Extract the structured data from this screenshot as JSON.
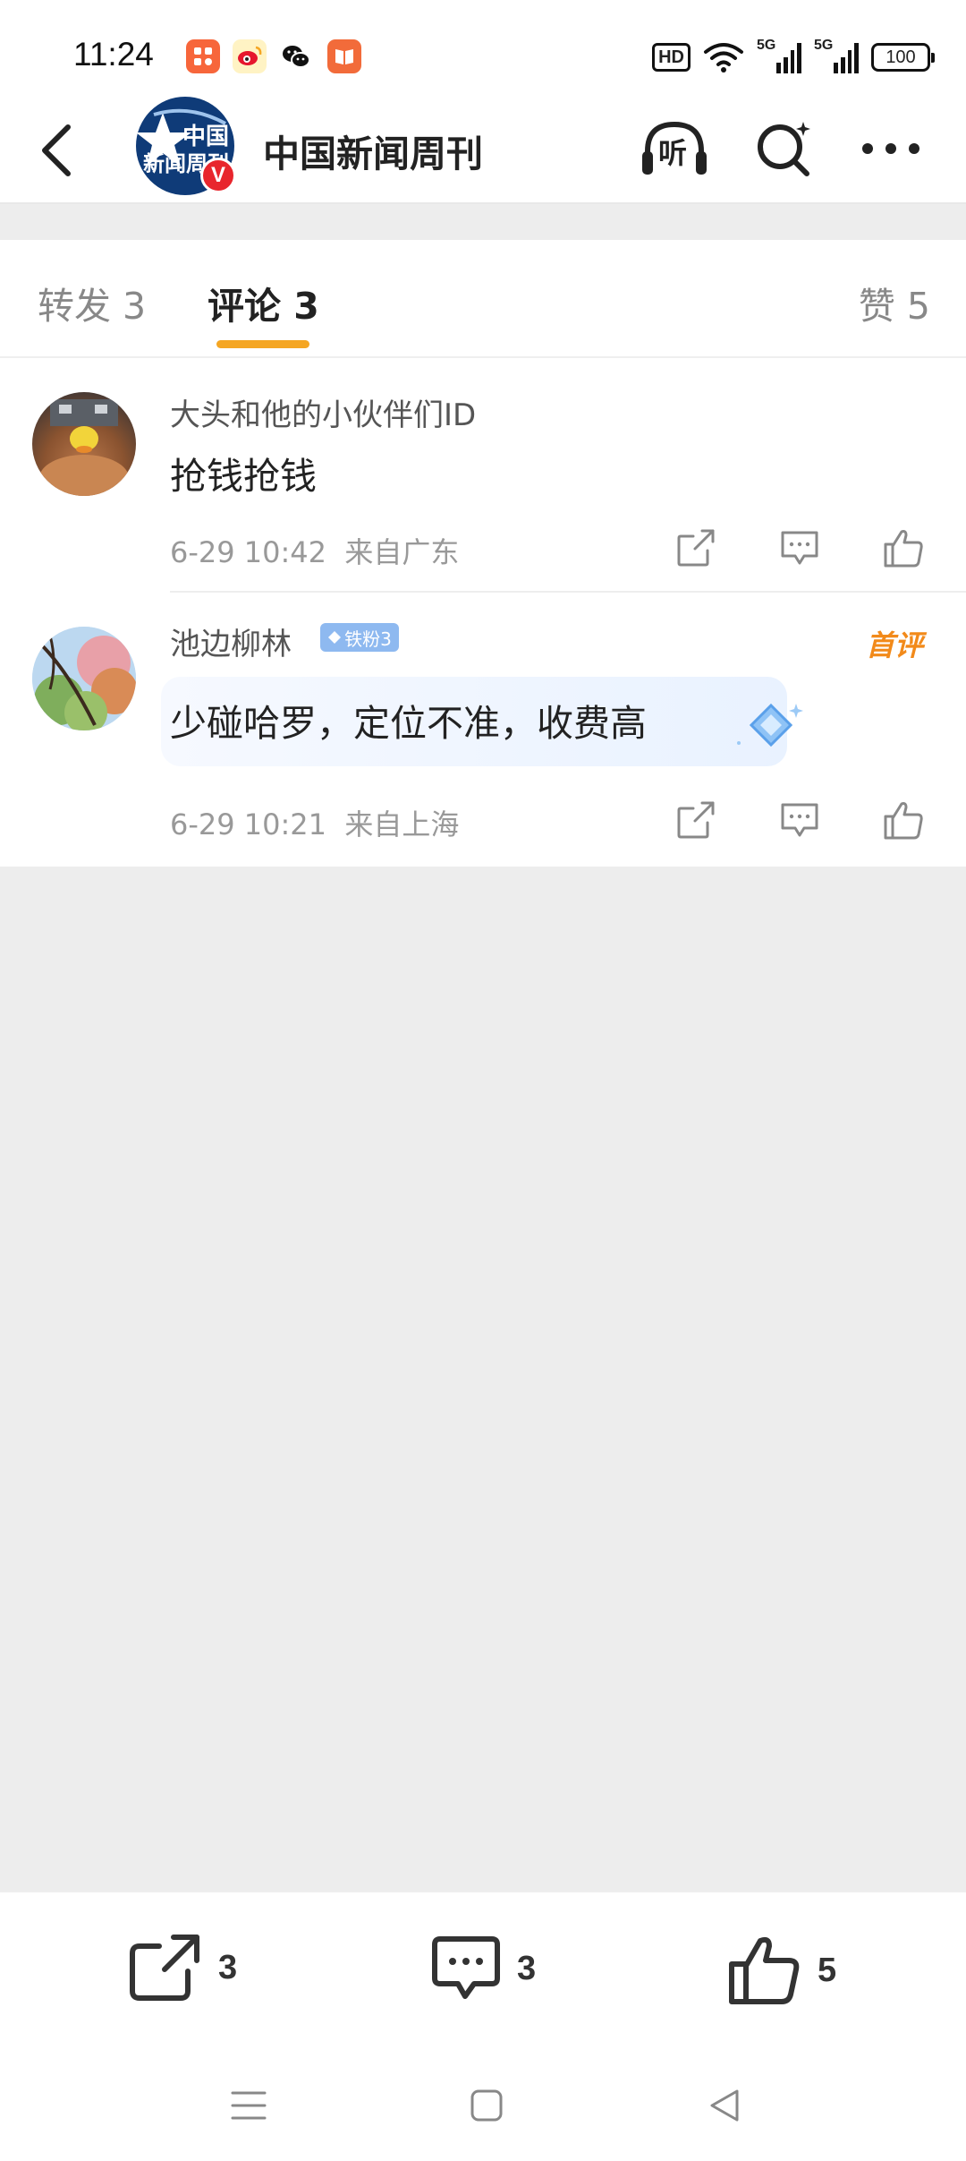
{
  "status_bar": {
    "time": "11:24",
    "network_label": "5G",
    "hd_label": "HD",
    "battery": "100"
  },
  "header": {
    "logo_text_line1": "中国",
    "logo_text_line2": "新闻周刊",
    "verified_mark": "V",
    "title": "中国新闻周刊",
    "listen_label": "听"
  },
  "tabs": [
    {
      "label": "转发 3"
    },
    {
      "label": "评论 3"
    },
    {
      "label": "赞 5"
    }
  ],
  "comments": [
    {
      "username": "大头和他的小伙伴们ID",
      "text": "抢钱抢钱",
      "time": "6-29 10:42",
      "location": "来自广东"
    },
    {
      "username": "池边柳林",
      "fan_badge": "铁粉3",
      "first_badge": "首评",
      "text": "少碰哈罗，定位不准，收费高",
      "time": "6-29 10:21",
      "location": "来自上海"
    }
  ],
  "bottom_bar": {
    "repost_count": "3",
    "comment_count": "3",
    "like_count": "5"
  },
  "colors": {
    "accent": "#f5a623",
    "verified": "#e8262d",
    "fan_badge": "#8eb9f0",
    "first_badge": "#f28a1a"
  }
}
